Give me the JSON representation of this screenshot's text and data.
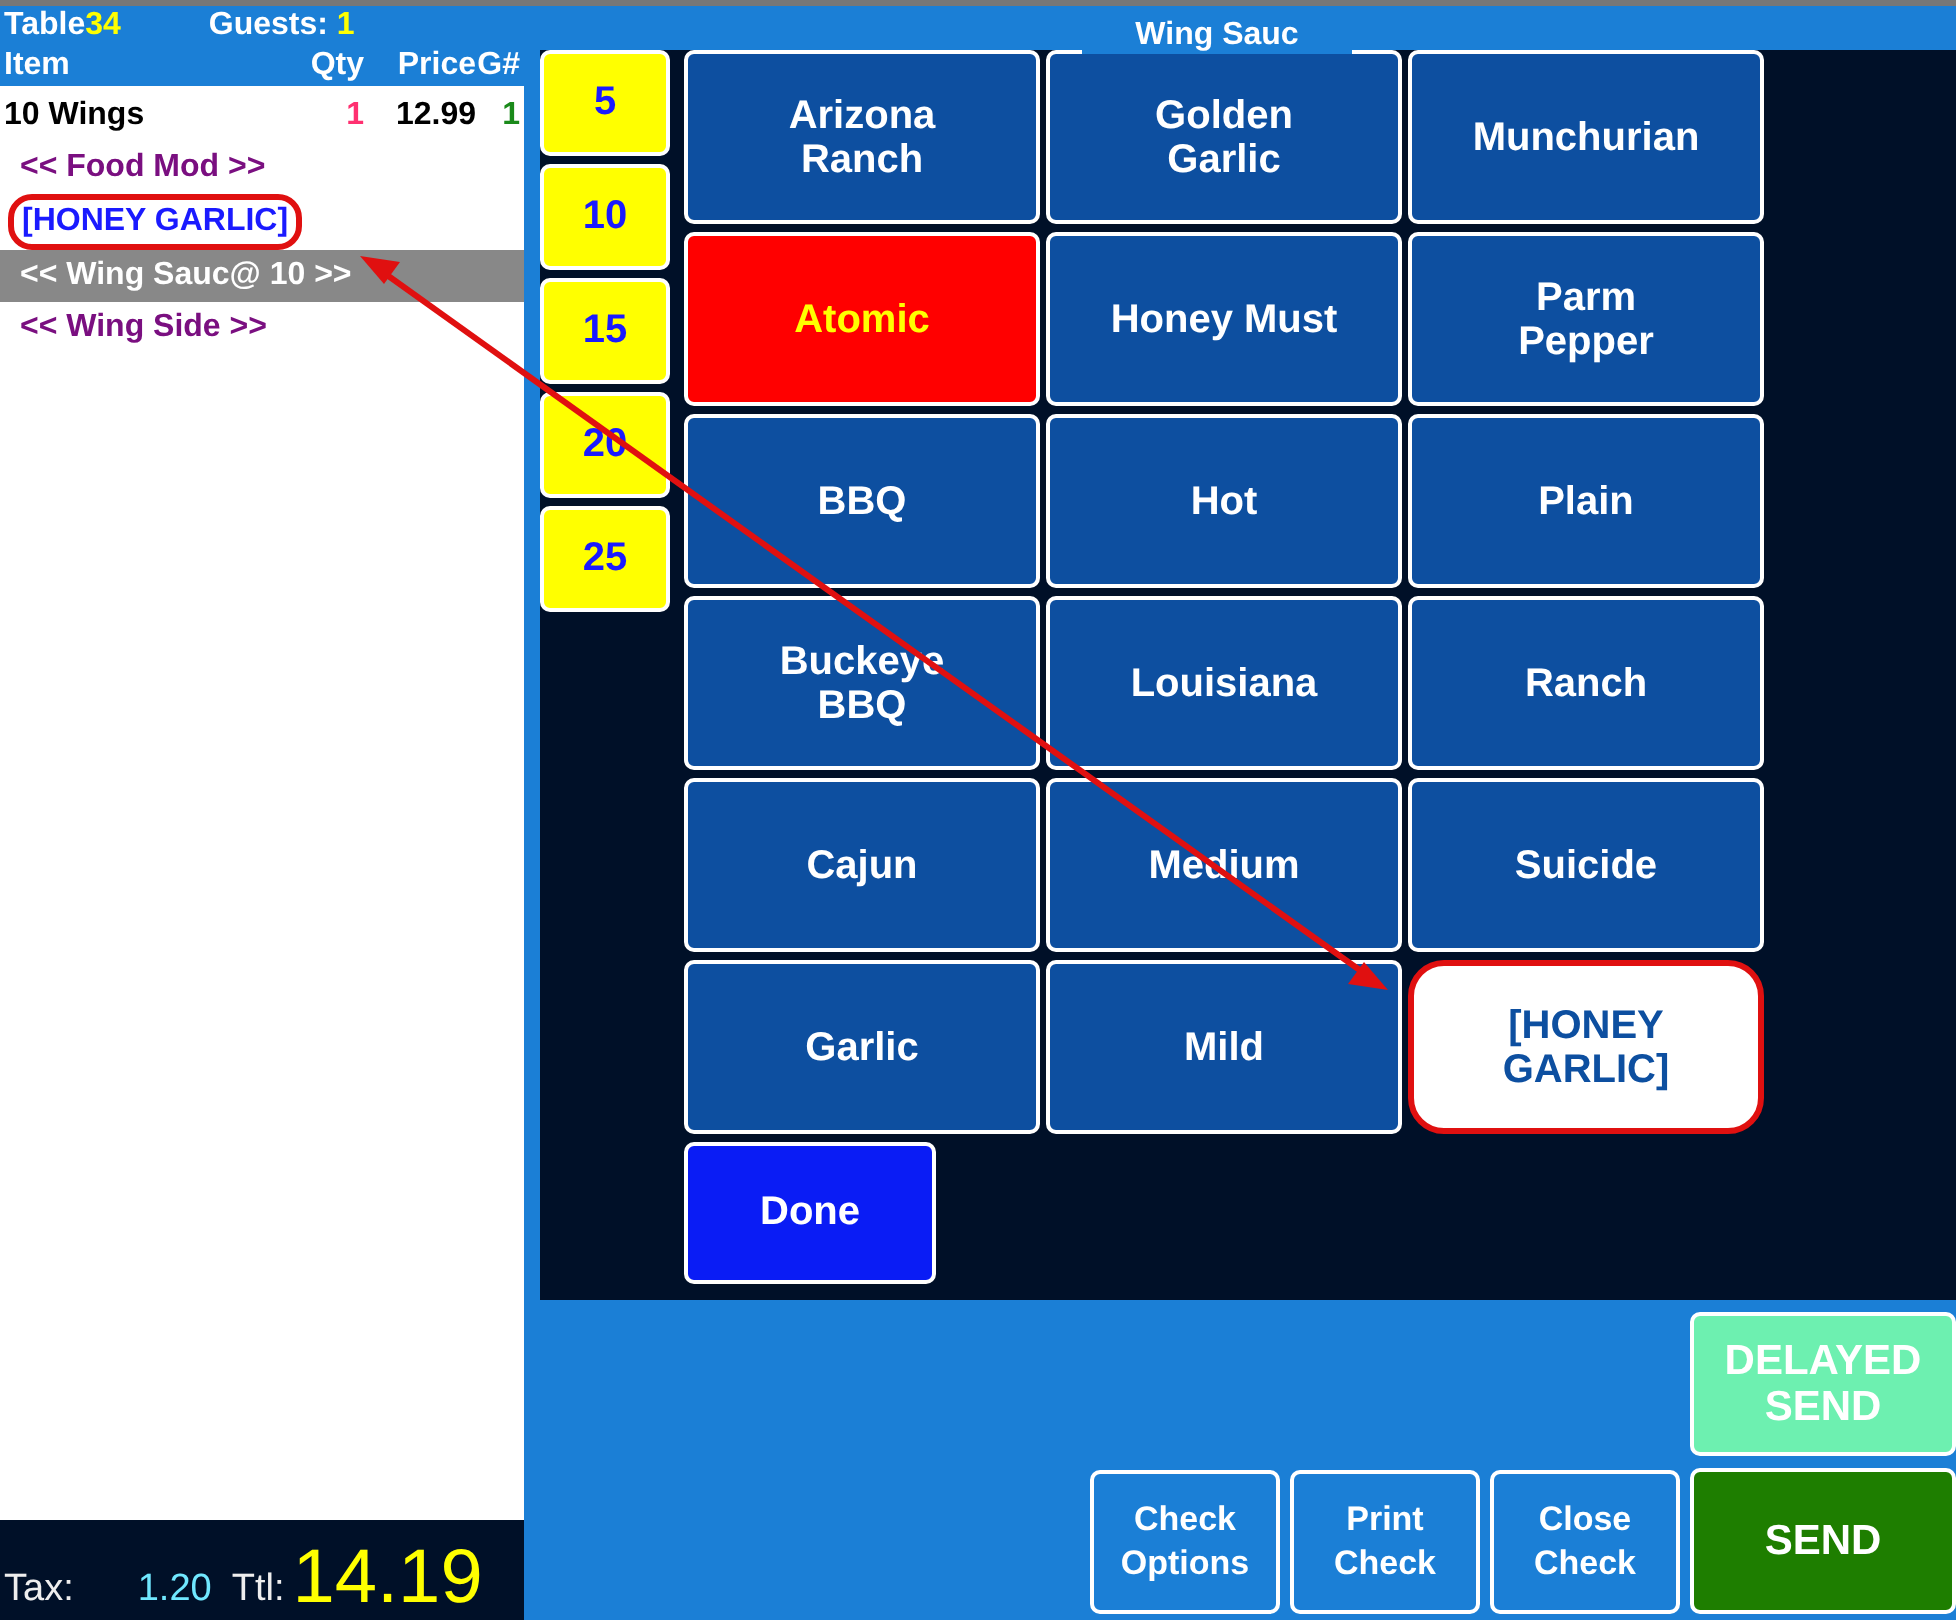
{
  "header": {
    "table_label": "Table",
    "table_number": "34",
    "guests_label": "Guests:",
    "guests": "1"
  },
  "columns": {
    "item": "Item",
    "qty": "Qty",
    "price": "Price",
    "guest": "G#"
  },
  "order_lines": [
    {
      "kind": "item",
      "text": "10 Wings",
      "qty": "1",
      "price": "12.99",
      "guest": "1",
      "selected": false
    },
    {
      "kind": "modifier",
      "text": "<< Food Mod >>",
      "selected": false
    },
    {
      "kind": "custom",
      "text": "[HONEY GARLIC]",
      "selected": false,
      "circled": true
    },
    {
      "kind": "modifier",
      "text": "<< Wing Sauc@ 10 >>",
      "selected": true
    },
    {
      "kind": "modifier",
      "text": "<< Wing Side >>",
      "selected": false
    }
  ],
  "totals": {
    "tax_label": "Tax:",
    "tax": "1.20",
    "total_label": "Ttl:",
    "total": "14.19"
  },
  "panel_title": "Wing Sauc",
  "quantities": [
    "5",
    "10",
    "15",
    "20",
    "25"
  ],
  "sauces": [
    {
      "label": "Arizona Ranch",
      "kind": "normal",
      "circled": false
    },
    {
      "label": "Golden Garlic",
      "kind": "normal",
      "circled": false
    },
    {
      "label": "Munchurian",
      "kind": "normal",
      "circled": false
    },
    {
      "label": "Atomic",
      "kind": "hot",
      "circled": false
    },
    {
      "label": "Honey Must",
      "kind": "normal",
      "circled": false
    },
    {
      "label": "Parm Pepper",
      "kind": "normal",
      "circled": false
    },
    {
      "label": "BBQ",
      "kind": "normal",
      "circled": false
    },
    {
      "label": "Hot",
      "kind": "normal",
      "circled": false
    },
    {
      "label": "Plain",
      "kind": "normal",
      "circled": false
    },
    {
      "label": "Buckeye BBQ",
      "kind": "normal",
      "circled": false
    },
    {
      "label": "Louisiana",
      "kind": "normal",
      "circled": false
    },
    {
      "label": "Ranch",
      "kind": "normal",
      "circled": false
    },
    {
      "label": "Cajun",
      "kind": "normal",
      "circled": false
    },
    {
      "label": "Medium",
      "kind": "normal",
      "circled": false
    },
    {
      "label": "Suicide",
      "kind": "normal",
      "circled": false
    },
    {
      "label": "Garlic",
      "kind": "normal",
      "circled": false
    },
    {
      "label": "Mild",
      "kind": "normal",
      "circled": false
    },
    {
      "label": "[HONEY GARLIC]",
      "kind": "chosen",
      "circled": true
    }
  ],
  "done_button": "Done",
  "actions": [
    {
      "label": "Check Options",
      "kind": "plain"
    },
    {
      "label": "Print Check",
      "kind": "plain"
    },
    {
      "label": "Close Check",
      "kind": "plain"
    }
  ],
  "delayed_send": "DELAYED SEND",
  "send": "SEND"
}
